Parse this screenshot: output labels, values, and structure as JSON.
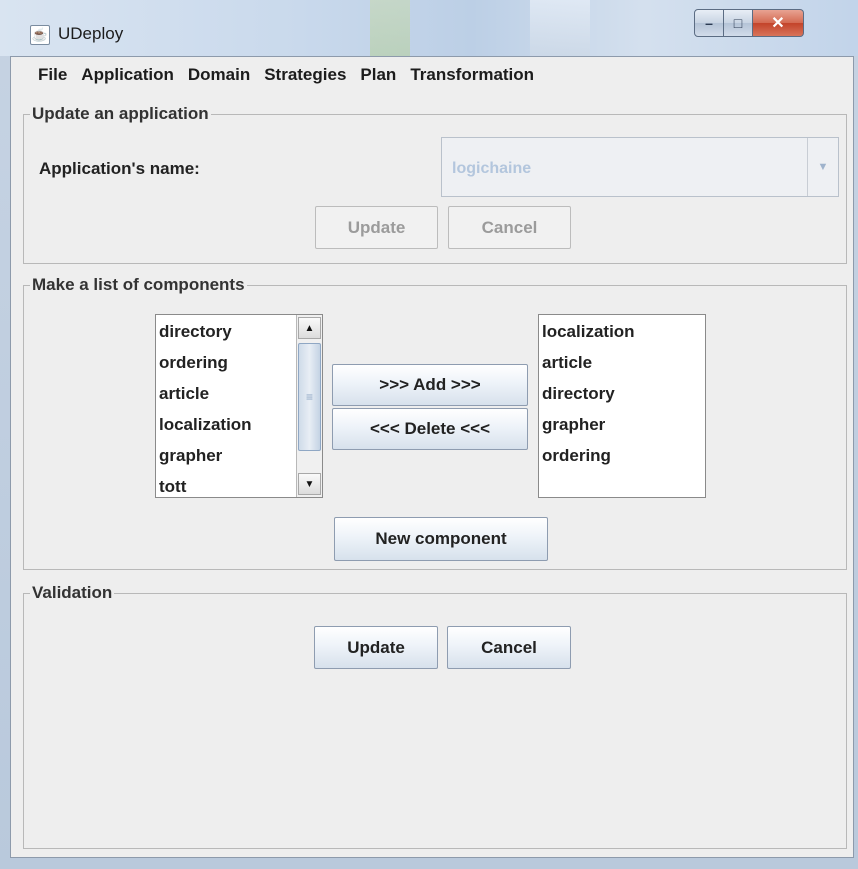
{
  "window": {
    "title": "UDeploy",
    "icon": "java-cup-icon"
  },
  "menu": [
    "File",
    "Application",
    "Domain",
    "Strategies",
    "Plan",
    "Transformation"
  ],
  "update_section": {
    "legend": "Update an application",
    "name_label": "Application's name:",
    "name_value": "logichaine",
    "update_label": "Update",
    "cancel_label": "Cancel"
  },
  "components_section": {
    "legend": "Make a list of components",
    "available": [
      "directory",
      "ordering",
      "article",
      "localization",
      "grapher",
      "tott"
    ],
    "selected": [
      "localization",
      "article",
      "directory",
      "grapher",
      "ordering"
    ],
    "add_label": ">>> Add >>>",
    "delete_label": "<<< Delete <<<",
    "new_label": "New component"
  },
  "validation_section": {
    "legend": "Validation",
    "update_label": "Update",
    "cancel_label": "Cancel"
  }
}
